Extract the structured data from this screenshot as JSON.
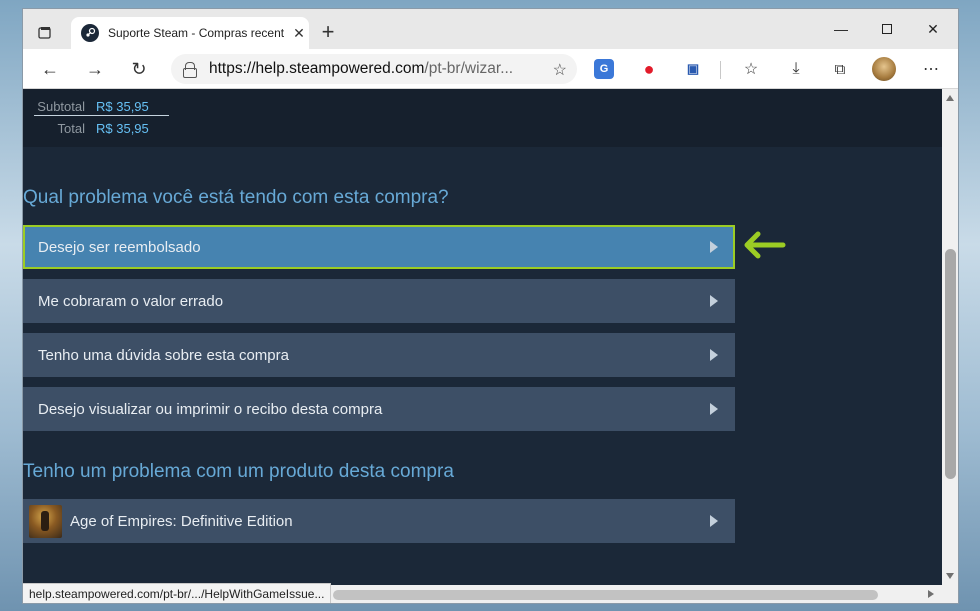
{
  "browser": {
    "tab_title": "Suporte Steam - Compras recentes",
    "url_host": "https://help.steampowered.com",
    "url_path": "/pt-br/wizar...",
    "status_url": "help.steampowered.com/pt-br/.../HelpWithGameIssue..."
  },
  "receipt": {
    "subtotal_label": "Subtotal",
    "subtotal_value": "R$ 35,95",
    "total_label": "Total",
    "total_value": "R$ 35,95"
  },
  "purchase_section": {
    "title": "Qual problema você está tendo com esta compra?",
    "options": [
      {
        "label": "Desejo ser reembolsado",
        "selected": true
      },
      {
        "label": "Me cobraram o valor errado",
        "selected": false
      },
      {
        "label": "Tenho uma dúvida sobre esta compra",
        "selected": false
      },
      {
        "label": "Desejo visualizar ou imprimir o recibo desta compra",
        "selected": false
      }
    ]
  },
  "product_section": {
    "title": "Tenho um problema com um produto desta compra",
    "products": [
      {
        "label": "Age of Empires: Definitive Edition"
      }
    ]
  },
  "colors": {
    "accent_highlight": "#9ccc24",
    "selected_option_bg": "#4683b0",
    "option_bg": "#3d4f66",
    "section_title": "#67a9d6",
    "page_bg": "#1b2838"
  }
}
